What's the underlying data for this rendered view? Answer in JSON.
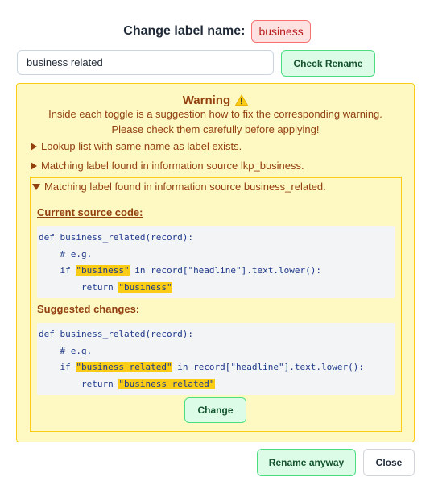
{
  "header": {
    "title": "Change label name:",
    "label": "business"
  },
  "rename": {
    "input_value": "business related",
    "check_button": "Check Rename"
  },
  "warning": {
    "title": "Warning",
    "icon": "warning-triangle-icon",
    "description_line1": "Inside each toggle is a suggestion how to fix the corresponding warning.",
    "description_line2": "Please check them carefully before applying!",
    "toggles": [
      {
        "label": "Lookup list with same name as label exists.",
        "expanded": false
      },
      {
        "label": "Matching label found in information source lkp_business.",
        "expanded": false
      },
      {
        "label": "Matching label found in information source business_related.",
        "expanded": true
      }
    ],
    "current_title": "Current source code:",
    "current_code": {
      "line1": "def business_related(record):",
      "line2": "    # e.g.",
      "line3_pre": "    if ",
      "line3_hl": "\"business\"",
      "line3_post": " in record[\"headline\"].text.lower():",
      "line4_pre": "        return ",
      "line4_hl": "\"business\""
    },
    "suggested_title": "Suggested changes:",
    "suggested_code": {
      "line1": "def business_related(record):",
      "line2": "    # e.g.",
      "line3_pre": "    if ",
      "line3_hl": "\"business related\"",
      "line3_post": " in record[\"headline\"].text.lower():",
      "line4_pre": "        return ",
      "line4_hl": "\"business related\""
    },
    "change_button": "Change"
  },
  "footer": {
    "rename_anyway": "Rename anyway",
    "close": "Close"
  },
  "colors": {
    "warning_bg": "#fef9c3",
    "warning_border": "#facc15",
    "warning_text": "#92400e",
    "green_button_bg": "#dcfce7",
    "green_button_border": "#4ade80",
    "label_badge_bg": "#fee2e2",
    "label_badge_border": "#f87171",
    "code_text": "#1e3a8a",
    "highlight": "#facc15"
  }
}
